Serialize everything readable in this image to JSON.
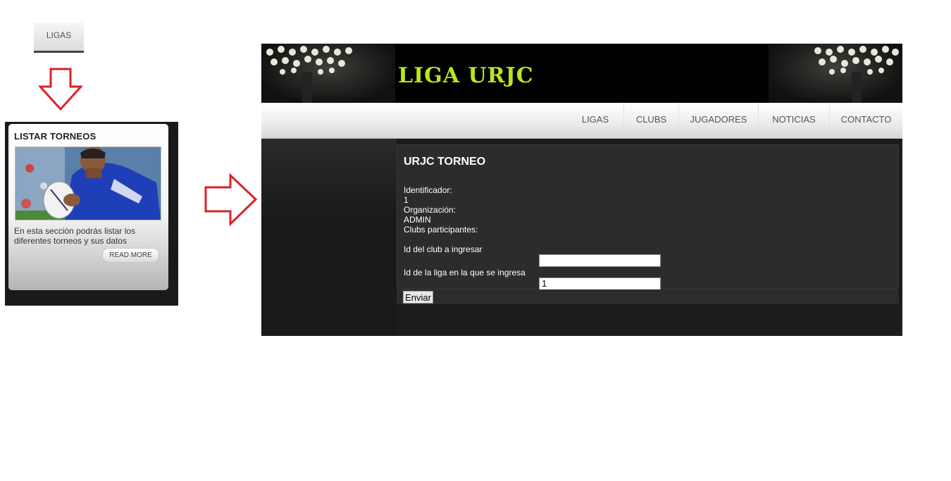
{
  "left_panel": {
    "tab_label": "LIGAS",
    "card": {
      "title": "LISTAR TORNEOS",
      "description": "En esta sección podrás listar los diferentes torneos y sus datos",
      "read_more": "READ MORE"
    }
  },
  "site": {
    "logo": "LIGA URJC",
    "nav": [
      "LIGAS",
      "CLUBS",
      "JUGADORES",
      "NOTICIAS",
      "CONTACTO"
    ],
    "page_title": "URJC TORNEO",
    "fields": {
      "id_label": "Identificador:",
      "id_value": "1",
      "org_label": "Organización:",
      "org_value": "ADMIN",
      "clubs_label": "Clubs participantes:",
      "club_input_label": "Id del club a ingresar",
      "club_input_value": "",
      "liga_input_label": "Id de la liga en la que se ingresa",
      "liga_input_value": "1"
    },
    "submit": "Enviar"
  },
  "colors": {
    "arrow": "#d9222a",
    "logo": "#b8e61c"
  }
}
